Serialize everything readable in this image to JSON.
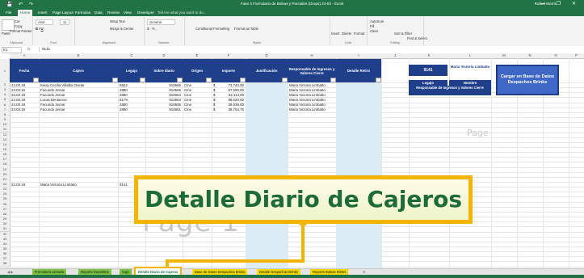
{
  "window": {
    "title": "Fase 3 Formulario de Bolsas y Parciales (Drops) 24-03 - Excel",
    "user": "Rafael Morris",
    "qat_icons": [
      "save-icon",
      "undo-icon",
      "redo-icon"
    ],
    "window_buttons": [
      "—",
      "❐",
      "✕"
    ]
  },
  "ribbon_tabs": [
    "File",
    "Home",
    "Insert",
    "Page Layout",
    "Formulas",
    "Data",
    "Review",
    "View",
    "Developer",
    "Tell me what you want to do..."
  ],
  "ribbon": {
    "clipboard": {
      "cut": "Cut",
      "copy": "Copy",
      "paste": "Paste",
      "format_painter": "Format Painter",
      "label": "Clipboard"
    },
    "font": {
      "name": "Arial",
      "size": "11",
      "label": "Font"
    },
    "alignment": {
      "wrap": "Wrap Text",
      "merge": "Merge & Center",
      "label": "Alignment"
    },
    "number": {
      "format": "General",
      "label": "Number"
    },
    "styles": {
      "conditional": "Conditional Formatting",
      "format_as": "Format as Table",
      "label": "Styles"
    },
    "cells": {
      "insert": "Insert",
      "delete": "Delete",
      "format": "Format",
      "label": "Cells"
    },
    "editing": {
      "autosum": "AutoSum",
      "fill": "Fill",
      "clear": "Clear",
      "sort": "Sort & Filter",
      "find": "Find & Select",
      "label": "Editing"
    }
  },
  "formula_bar": {
    "cell": "K1",
    "fx": "fx",
    "value": "9141"
  },
  "columns": [
    "A",
    "B",
    "C",
    "D",
    "E",
    "F",
    "G",
    "H",
    "I",
    "J",
    "K",
    "L",
    "M",
    "N",
    "O",
    "P"
  ],
  "table": {
    "headers": [
      "Fecha",
      "Cajero",
      "Legajo",
      "Sobre diario",
      "Origen",
      "Importe",
      "Justificación",
      "Responsable de Ingresos y Valores Cierre",
      "Detalle Retiro"
    ],
    "rows": [
      {
        "row": "2",
        "fecha": "24.03.19",
        "cajero": "Keisy Cecilia Villalba Ovelar",
        "legajo": "6922",
        "sobre": "910666",
        "origen": "Cine",
        "moneda": "$",
        "importe": "73.740,00",
        "responsable": "Maria Victoria Limbatto"
      },
      {
        "row": "3",
        "fecha": "24.03.19",
        "cajero": "Facundo Jemar",
        "legajo": "2880",
        "sobre": "910665",
        "origen": "Cine",
        "moneda": "$",
        "importe": "67.590,00",
        "responsable": "Maria Victoria Limbatto"
      },
      {
        "row": "4",
        "fecha": "24.03.19",
        "cajero": "Facundo Jemar",
        "legajo": "2880",
        "sobre": "910664",
        "origen": "Cine",
        "moneda": "$",
        "importe": "62.114,00",
        "responsable": "Maria Victoria Limbatto"
      },
      {
        "row": "5",
        "fecha": "24.03.19",
        "cajero": "Lucas Bentancur",
        "legajo": "8179",
        "sobre": "910663",
        "origen": "Cine",
        "moneda": "$",
        "importe": "98.920,00",
        "responsable": "Maria Victoria Limbatto"
      },
      {
        "row": "6",
        "fecha": "24.03.19",
        "cajero": "Facundo Jemar",
        "legajo": "2880",
        "sobre": "910655",
        "origen": "Cine",
        "moneda": "$",
        "importe": "39.938,00",
        "responsable": "Maria Victoria Limbatto"
      },
      {
        "row": "7",
        "fecha": "24.03.19",
        "cajero": "Facundo Jemar",
        "legajo": "2880",
        "sobre": "910651",
        "origen": "Cine",
        "moneda": "$",
        "importe": "35.704,75",
        "responsable": "Maria Victoria Limbatto"
      }
    ],
    "extra_row": {
      "row": "22",
      "fecha": "24.03.19",
      "cajero": "Maria Victoria Limbatto",
      "legajo": "9141",
      "sobre": "910652",
      "origen": "Cine",
      "moneda": "$",
      "importe": "183,00",
      "responsable": "Maria Victoria Limbatto"
    }
  },
  "panel": {
    "legajo_value": "9141",
    "nombre_value": "Maria Victoria Limbatto",
    "legajo_label": "Legajo",
    "nombre_label": "Nombre",
    "responsable_label": "Responsable de Ingresos y Valores Cierre",
    "button_label": "Cargar en Base de Datos Despachos Brinks"
  },
  "watermark": "Page 1",
  "watermark_small": "Page",
  "callout": "Detalle Diario de Cajeros",
  "sheet_tabs": [
    "Formulario Llenado",
    "Reporte Depósitos",
    "Caja",
    "Detalle Diario de Cajeros",
    "Base de Datos Despachos Brinks",
    "Detalle Despachos Brinks",
    "Reporte Bolsas Brinks"
  ],
  "row_numbers": [
    "1",
    "2",
    "3",
    "4",
    "5",
    "6",
    "7",
    "8",
    "9",
    "10",
    "11",
    "12",
    "13",
    "14",
    "15",
    "16",
    "17",
    "18",
    "19",
    "20",
    "21",
    "22",
    "23",
    "24",
    "25",
    "26",
    "27",
    "28",
    "29",
    "30",
    "31",
    "32",
    "33",
    "34",
    "35",
    "36",
    "37",
    "38"
  ]
}
